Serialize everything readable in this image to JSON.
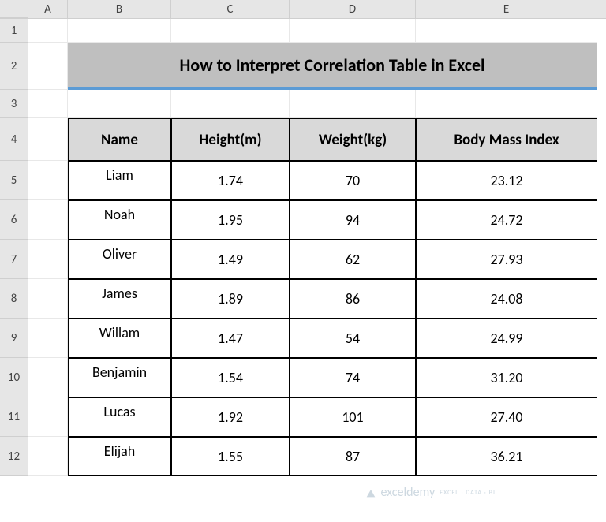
{
  "columns": [
    "A",
    "B",
    "C",
    "D",
    "E"
  ],
  "rows": [
    "1",
    "2",
    "3",
    "4",
    "5",
    "6",
    "7",
    "8",
    "9",
    "10",
    "11",
    "12"
  ],
  "title": "How to Interpret Correlation Table in Excel",
  "headers": {
    "name": "Name",
    "height": "Height(m)",
    "weight": "Weight(kg)",
    "bmi": "Body Mass Index"
  },
  "data": [
    {
      "name": "Liam",
      "height": "1.74",
      "weight": "70",
      "bmi": "23.12"
    },
    {
      "name": "Noah",
      "height": "1.95",
      "weight": "94",
      "bmi": "24.72"
    },
    {
      "name": "Oliver",
      "height": "1.49",
      "weight": "62",
      "bmi": "27.93"
    },
    {
      "name": "James",
      "height": "1.89",
      "weight": "86",
      "bmi": "24.08"
    },
    {
      "name": "Willam",
      "height": "1.47",
      "weight": "54",
      "bmi": "24.99"
    },
    {
      "name": "Benjamin",
      "height": "1.54",
      "weight": "74",
      "bmi": "31.20"
    },
    {
      "name": "Lucas",
      "height": "1.92",
      "weight": "101",
      "bmi": "27.40"
    },
    {
      "name": "Elijah",
      "height": "1.55",
      "weight": "87",
      "bmi": "36.21"
    }
  ],
  "watermark": {
    "text": "exceldemy",
    "sub": "EXCEL · DATA · BI"
  },
  "chart_data": {
    "type": "table",
    "title": "How to Interpret Correlation Table in Excel",
    "columns": [
      "Name",
      "Height(m)",
      "Weight(kg)",
      "Body Mass Index"
    ],
    "rows": [
      [
        "Liam",
        1.74,
        70,
        23.12
      ],
      [
        "Noah",
        1.95,
        94,
        24.72
      ],
      [
        "Oliver",
        1.49,
        62,
        27.93
      ],
      [
        "James",
        1.89,
        86,
        24.08
      ],
      [
        "Willam",
        1.47,
        54,
        24.99
      ],
      [
        "Benjamin",
        1.54,
        74,
        31.2
      ],
      [
        "Lucas",
        1.92,
        101,
        27.4
      ],
      [
        "Elijah",
        1.55,
        87,
        36.21
      ]
    ]
  }
}
